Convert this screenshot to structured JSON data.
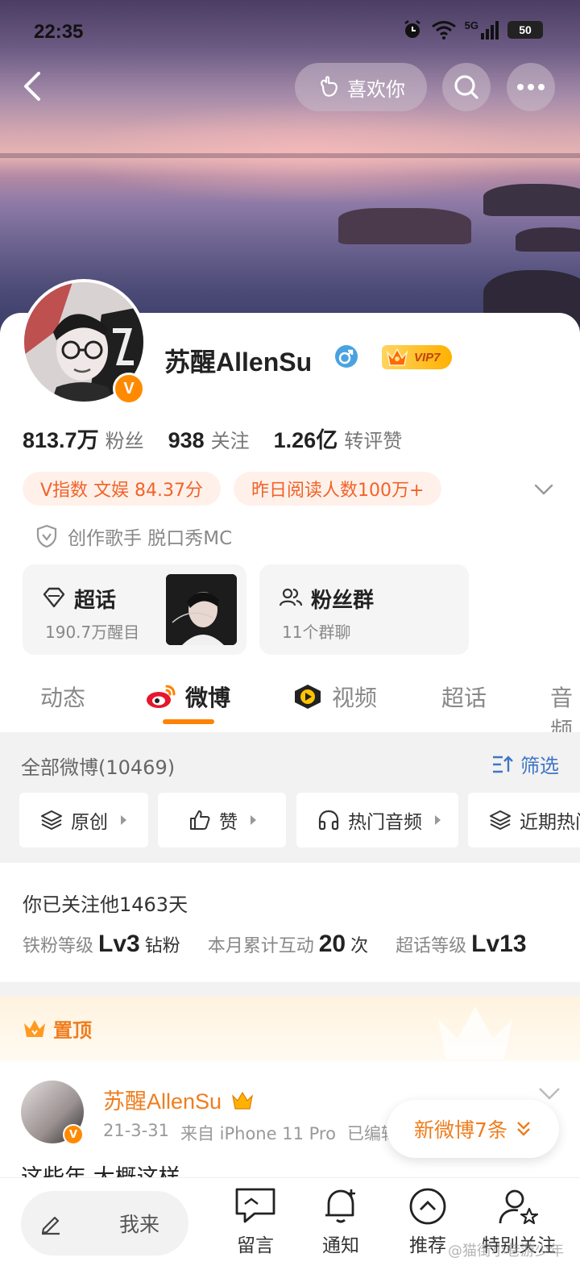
{
  "status_bar": {
    "time": "22:35",
    "battery": "50",
    "network": "5G"
  },
  "header": {
    "like_label": "喜欢你"
  },
  "profile": {
    "name": "苏醒AllenSu",
    "vip_label": "VIP7",
    "verified_mark": "V",
    "stats": [
      {
        "value": "813.7万",
        "label": "粉丝"
      },
      {
        "value": "938",
        "label": "关注"
      },
      {
        "value": "1.26亿",
        "label": "转评赞"
      }
    ],
    "tags": [
      "V指数 文娱 84.37分",
      "昨日阅读人数100万+"
    ],
    "certification": "创作歌手 脱口秀MC"
  },
  "features": {
    "topic": {
      "title": "超话",
      "subtitle": "190.7万醒目"
    },
    "group": {
      "title": "粉丝群",
      "subtitle": "11个群聊"
    }
  },
  "tabs": [
    {
      "label": "动态"
    },
    {
      "label": "微博"
    },
    {
      "label": "视频"
    },
    {
      "label": "超话"
    },
    {
      "label": "音频"
    }
  ],
  "filters": {
    "title": "全部微博(10469)",
    "link": "筛选",
    "chips": [
      {
        "label": "原创"
      },
      {
        "label": "赞"
      },
      {
        "label": "热门音频"
      },
      {
        "label": "近期热门"
      }
    ]
  },
  "follow_info": {
    "days_text": "你已关注他1463天",
    "iron_label": "铁粉等级",
    "iron_level": "Lv3",
    "iron_rank": "钻粉",
    "interact_label": "本月累计互动",
    "interact_count": "20",
    "interact_unit": "次",
    "topic_label": "超话等级",
    "topic_level": "Lv13"
  },
  "pinned": {
    "label": "置顶",
    "post": {
      "author": "苏醒AllenSu",
      "date": "21-3-31",
      "source": "来自 iPhone 11 Pro",
      "edited": "已编辑",
      "text": "这些年 大概这样"
    }
  },
  "new_posts": "新微博7条",
  "bottom_bar": {
    "compose_placeholder": "我来",
    "items": [
      {
        "label": "留言"
      },
      {
        "label": "通知"
      },
      {
        "label": "推荐"
      },
      {
        "label": "特别关注"
      }
    ]
  },
  "watermark": "@猫街小巷游少年",
  "colors": {
    "accent": "#ff8200",
    "link": "#3e76c6",
    "tag_text": "#f0632a",
    "tag_bg": "#fff1ea"
  }
}
